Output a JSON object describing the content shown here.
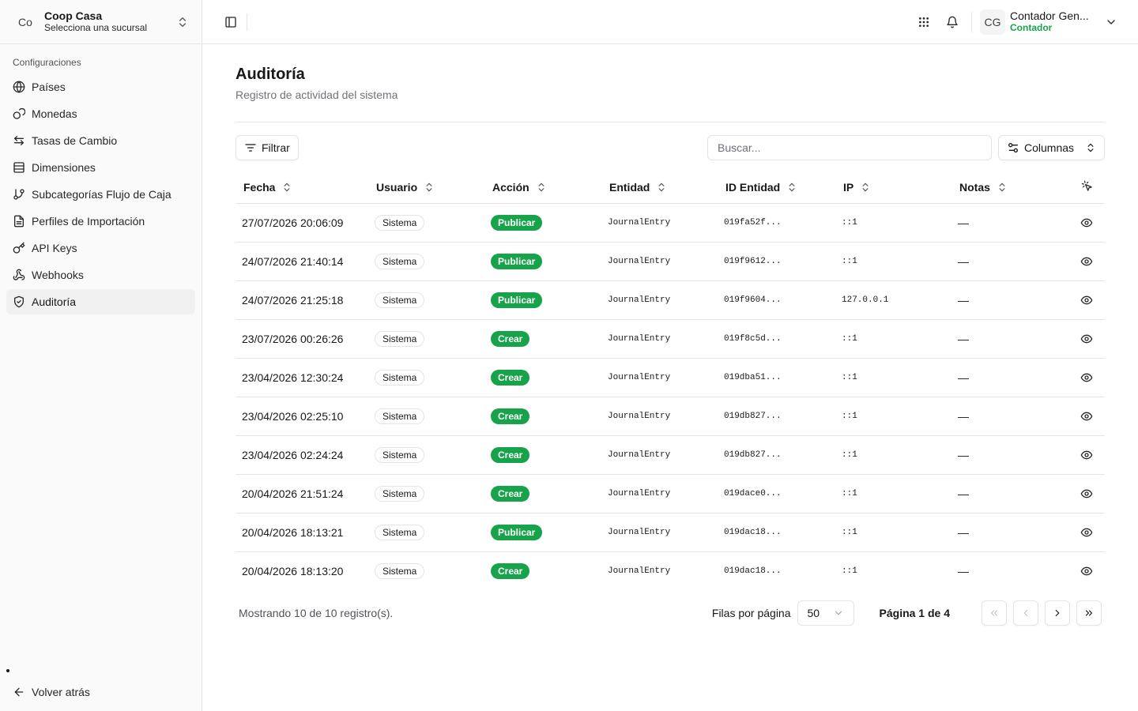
{
  "org": {
    "initials": "Co",
    "name": "Coop Casa",
    "subtitle": "Selecciona una sucursal"
  },
  "sidebar": {
    "group_label": "Configuraciones",
    "items": [
      {
        "label": "Países",
        "icon": "globe-icon"
      },
      {
        "label": "Monedas",
        "icon": "coins-icon"
      },
      {
        "label": "Tasas de Cambio",
        "icon": "arrows-exchange-icon"
      },
      {
        "label": "Dimensiones",
        "icon": "table-icon"
      },
      {
        "label": "Subcategorías Flujo de Caja",
        "icon": "git-branch-icon"
      },
      {
        "label": "Perfiles de Importación",
        "icon": "file-text-icon"
      },
      {
        "label": "API Keys",
        "icon": "key-icon"
      },
      {
        "label": "Webhooks",
        "icon": "webhook-icon"
      },
      {
        "label": "Auditoría",
        "icon": "shield-check-icon",
        "active": true
      }
    ],
    "back_label": "Volver atrás"
  },
  "user": {
    "initials": "CG",
    "name": "Contador Gen...",
    "role": "Contador",
    "role_color": "#16a34a"
  },
  "page": {
    "title": "Auditoría",
    "subtitle": "Registro de actividad del sistema"
  },
  "toolbar": {
    "filter_label": "Filtrar",
    "search_placeholder": "Buscar...",
    "columns_label": "Columnas"
  },
  "table": {
    "headers": {
      "fecha": "Fecha",
      "usuario": "Usuario",
      "accion": "Acción",
      "entidad": "Entidad",
      "id_entidad": "ID Entidad",
      "ip": "IP",
      "notas": "Notas"
    },
    "rows": [
      {
        "fecha": "27/07/2026 20:06:09",
        "usuario": "Sistema",
        "accion": "Publicar",
        "entidad": "JournalEntry",
        "id": "019fa52f...",
        "ip": "::1",
        "notas": "—"
      },
      {
        "fecha": "24/07/2026 21:40:14",
        "usuario": "Sistema",
        "accion": "Publicar",
        "entidad": "JournalEntry",
        "id": "019f9612...",
        "ip": "::1",
        "notas": "—"
      },
      {
        "fecha": "24/07/2026 21:25:18",
        "usuario": "Sistema",
        "accion": "Publicar",
        "entidad": "JournalEntry",
        "id": "019f9604...",
        "ip": "127.0.0.1",
        "notas": "—"
      },
      {
        "fecha": "23/07/2026 00:26:26",
        "usuario": "Sistema",
        "accion": "Crear",
        "entidad": "JournalEntry",
        "id": "019f8c5d...",
        "ip": "::1",
        "notas": "—"
      },
      {
        "fecha": "23/04/2026 12:30:24",
        "usuario": "Sistema",
        "accion": "Crear",
        "entidad": "JournalEntry",
        "id": "019dba51...",
        "ip": "::1",
        "notas": "—"
      },
      {
        "fecha": "23/04/2026 02:25:10",
        "usuario": "Sistema",
        "accion": "Crear",
        "entidad": "JournalEntry",
        "id": "019db827...",
        "ip": "::1",
        "notas": "—"
      },
      {
        "fecha": "23/04/2026 02:24:24",
        "usuario": "Sistema",
        "accion": "Crear",
        "entidad": "JournalEntry",
        "id": "019db827...",
        "ip": "::1",
        "notas": "—"
      },
      {
        "fecha": "20/04/2026 21:51:24",
        "usuario": "Sistema",
        "accion": "Crear",
        "entidad": "JournalEntry",
        "id": "019dace0...",
        "ip": "::1",
        "notas": "—"
      },
      {
        "fecha": "20/04/2026 18:13:21",
        "usuario": "Sistema",
        "accion": "Publicar",
        "entidad": "JournalEntry",
        "id": "019dac18...",
        "ip": "::1",
        "notas": "—"
      },
      {
        "fecha": "20/04/2026 18:13:20",
        "usuario": "Sistema",
        "accion": "Crear",
        "entidad": "JournalEntry",
        "id": "019dac18...",
        "ip": "::1",
        "notas": "—"
      }
    ]
  },
  "pagination": {
    "info": "Mostrando 10 de 10 registro(s).",
    "rows_label": "Filas por página",
    "rows_value": "50",
    "page_label": "Página 1 de 4"
  },
  "colors": {
    "accent_green": "#16a34a",
    "border": "#e5e5e5"
  }
}
